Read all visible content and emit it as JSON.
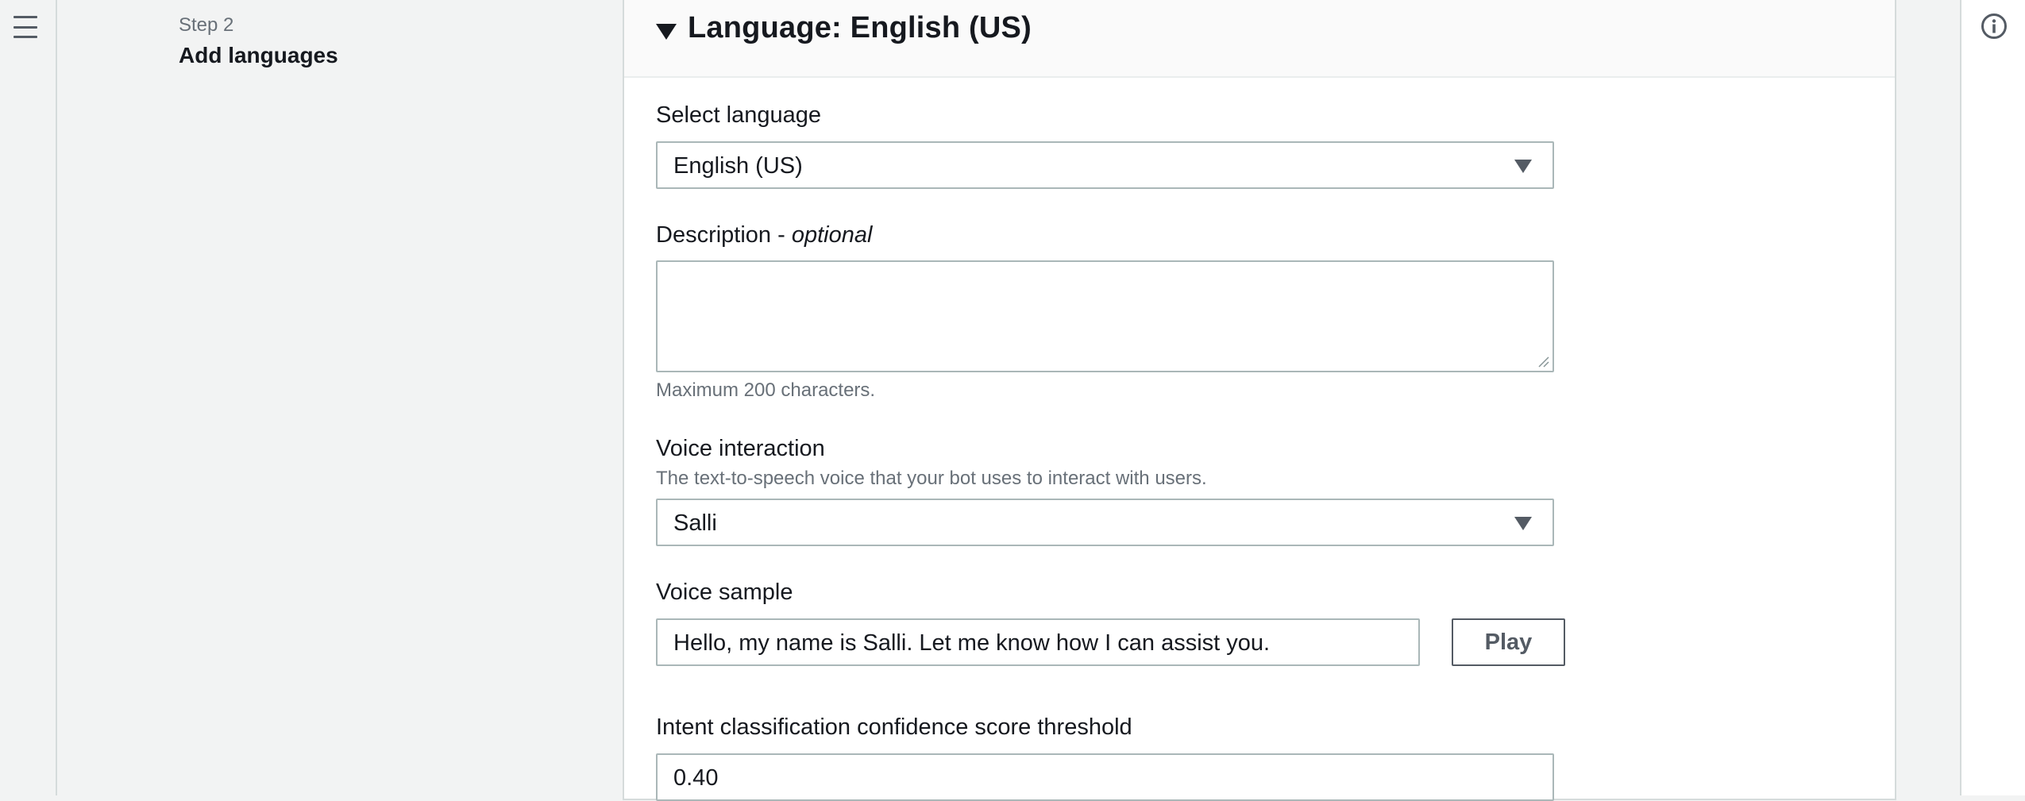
{
  "step": {
    "label": "Step 2",
    "title": "Add languages"
  },
  "panel": {
    "title": "Language: English (US)"
  },
  "select_language": {
    "label": "Select language",
    "value": "English (US)"
  },
  "description": {
    "label": "Description - ",
    "label_optional": "optional",
    "value": "",
    "hint": "Maximum 200 characters."
  },
  "voice_interaction": {
    "label": "Voice interaction",
    "hint": "The text-to-speech voice that your bot uses to interact with users.",
    "value": "Salli"
  },
  "voice_sample": {
    "label": "Voice sample",
    "value": "Hello, my name is Salli. Let me know how I can assist you.",
    "play_label": "Play"
  },
  "threshold": {
    "label": "Intent classification confidence score threshold",
    "value": "0.40"
  },
  "icons": {
    "menu": "hamburger-menu-icon",
    "collapse": "caret-down-icon",
    "dropdown": "dropdown-arrow-icon",
    "info": "info-icon"
  },
  "colors": {
    "background": "#f2f3f3",
    "border": "#aab7b8",
    "text": "#16191f",
    "muted": "#687078"
  }
}
